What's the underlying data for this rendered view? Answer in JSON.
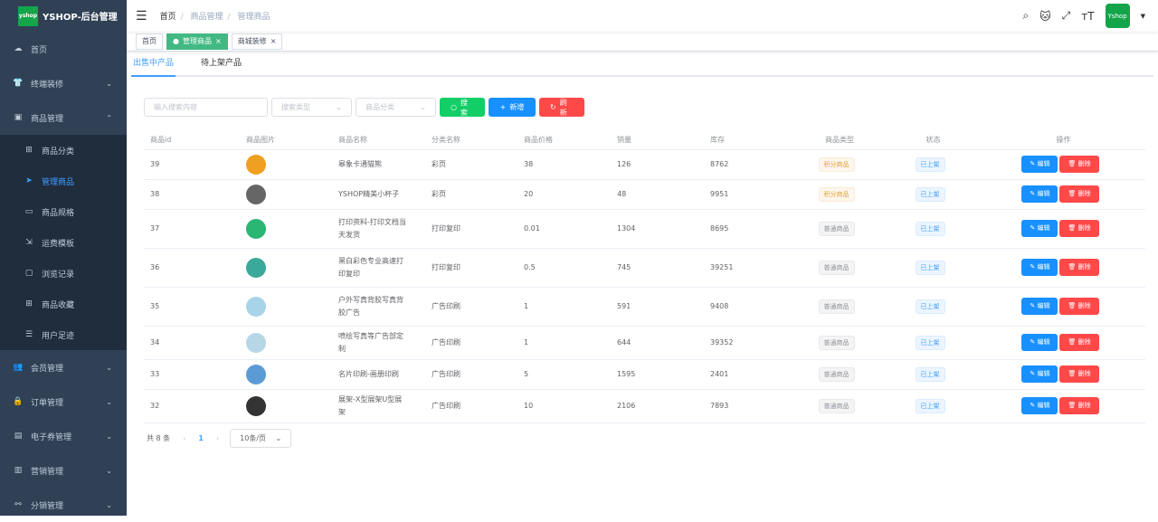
{
  "app": {
    "title": "YSHOP-后台管理",
    "logo_text": "yshop"
  },
  "sidebar": {
    "items": [
      {
        "label": "首页",
        "icon": "dashboard-icon"
      },
      {
        "label": "终端装修",
        "icon": "shirt-icon",
        "chevron": "down"
      },
      {
        "label": "商品管理",
        "icon": "shop-icon",
        "chevron": "up"
      },
      {
        "label": "会员管理",
        "icon": "users-icon",
        "chevron": "down"
      },
      {
        "label": "订单管理",
        "icon": "lock-icon",
        "chevron": "down"
      },
      {
        "label": "电子券管理",
        "icon": "ticket-icon",
        "chevron": "down"
      },
      {
        "label": "营销管理",
        "icon": "chart-icon",
        "chevron": "down"
      },
      {
        "label": "分销管理",
        "icon": "share-icon",
        "chevron": "down"
      }
    ],
    "sub_items": [
      {
        "label": "商品分类"
      },
      {
        "label": "管理商品",
        "active": true
      },
      {
        "label": "商品规格"
      },
      {
        "label": "运费模板"
      },
      {
        "label": "浏览记录"
      },
      {
        "label": "商品收藏"
      },
      {
        "label": "用户足迹"
      }
    ]
  },
  "breadcrumb": [
    "首页",
    "商品管理",
    "管理商品"
  ],
  "avatar_text": "Yshop",
  "tags": [
    {
      "label": "首页"
    },
    {
      "label": "管理商品",
      "active": true
    },
    {
      "label": "商城装修"
    }
  ],
  "tabs": [
    "出售中产品",
    "待上架产品"
  ],
  "toolbar": {
    "search_placeholder": "输入搜索内容",
    "type_placeholder": "搜索类型",
    "category_placeholder": "商品分类",
    "search": "搜索",
    "add": "新增",
    "refresh": "刷新"
  },
  "table": {
    "headers": [
      "商品id",
      "商品图片",
      "商品名称",
      "分类名称",
      "商品价格",
      "销量",
      "库存",
      "商品类型",
      "状态",
      "操作"
    ],
    "rows": [
      {
        "id": "39",
        "name": "皋象卡通猫熊",
        "cat": "彩页",
        "price": "38",
        "sales": "126",
        "stock": "8762",
        "type": "积分商品",
        "status": "已上架",
        "img": "#f0a020"
      },
      {
        "id": "38",
        "name": "YSHOP精美小杯子",
        "cat": "彩页",
        "price": "20",
        "sales": "48",
        "stock": "9951",
        "type": "积分商品",
        "status": "已上架",
        "img": "#666"
      },
      {
        "id": "37",
        "name": "打印资料-打印文档当天发货",
        "cat": "打印复印",
        "price": "0.01",
        "sales": "1304",
        "stock": "8695",
        "type": "普通商品",
        "status": "已上架",
        "img": "#2bb673"
      },
      {
        "id": "36",
        "name": "黑白彩色专业高速打印复印",
        "cat": "打印复印",
        "price": "0.5",
        "sales": "745",
        "stock": "39251",
        "type": "普通商品",
        "status": "已上架",
        "img": "#3aa89a"
      },
      {
        "id": "35",
        "name": "户外写真背胶写真背胶广告",
        "cat": "广告印刷",
        "price": "1",
        "sales": "591",
        "stock": "9408",
        "type": "普通商品",
        "status": "已上架",
        "img": "#a8d4ea"
      },
      {
        "id": "34",
        "name": "喷绘写真等广告部定制",
        "cat": "广告印刷",
        "price": "1",
        "sales": "644",
        "stock": "39352",
        "type": "普通商品",
        "status": "已上架",
        "img": "#b7d6e6"
      },
      {
        "id": "33",
        "name": "名片印刷-画册印刷",
        "cat": "广告印刷",
        "price": "5",
        "sales": "1595",
        "stock": "2401",
        "type": "普通商品",
        "status": "已上架",
        "img": "#5b9bd5"
      },
      {
        "id": "32",
        "name": "展架-X型展架U型展架",
        "cat": "广告印刷",
        "price": "10",
        "sales": "2106",
        "stock": "7893",
        "type": "普通商品",
        "status": "已上架",
        "img": "#333"
      }
    ],
    "edit": "编辑",
    "delete": "删除"
  },
  "pagination": {
    "total": "共 8 条",
    "page": "1",
    "size": "10条/页"
  },
  "colors": {
    "sidebar": "#304156",
    "primary": "#409eff",
    "success": "#13ce66",
    "danger": "#ff4949",
    "tag_active": "#42b983"
  }
}
